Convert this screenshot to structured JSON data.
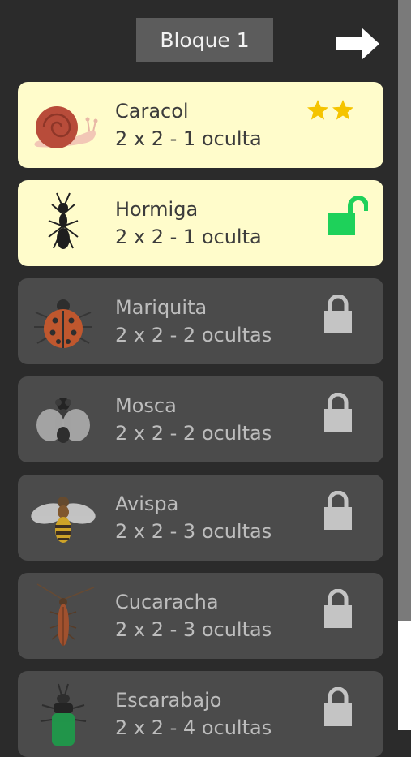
{
  "header": {
    "block_title": "Bloque 1",
    "next_icon": "arrow-right-icon"
  },
  "levels": [
    {
      "name": "Caracol",
      "subtitle": "2 x 2 - 1 oculta",
      "status": "completed",
      "stars": 2,
      "icon": "snail-icon"
    },
    {
      "name": "Hormiga",
      "subtitle": "2 x 2 - 1 oculta",
      "status": "unlocked",
      "icon": "ant-icon"
    },
    {
      "name": "Mariquita",
      "subtitle": "2 x 2 - 2 ocultas",
      "status": "locked",
      "icon": "ladybug-icon"
    },
    {
      "name": "Mosca",
      "subtitle": "2 x 2 - 2 ocultas",
      "status": "locked",
      "icon": "fly-icon"
    },
    {
      "name": "Avispa",
      "subtitle": "2 x 2 - 3 ocultas",
      "status": "locked",
      "icon": "wasp-icon"
    },
    {
      "name": "Cucaracha",
      "subtitle": "2 x 2 - 3 ocultas",
      "status": "locked",
      "icon": "cockroach-icon"
    },
    {
      "name": "Escarabajo",
      "subtitle": "2 x 2 - 4 ocultas",
      "status": "locked",
      "icon": "beetle-icon"
    }
  ],
  "colors": {
    "background": "#2b2b2b",
    "unlocked_card": "#fffccb",
    "locked_card": "#4b4b4b",
    "star": "#f5c400",
    "open_lock": "#1ed15a",
    "locked_lock": "#c4c4c4"
  }
}
